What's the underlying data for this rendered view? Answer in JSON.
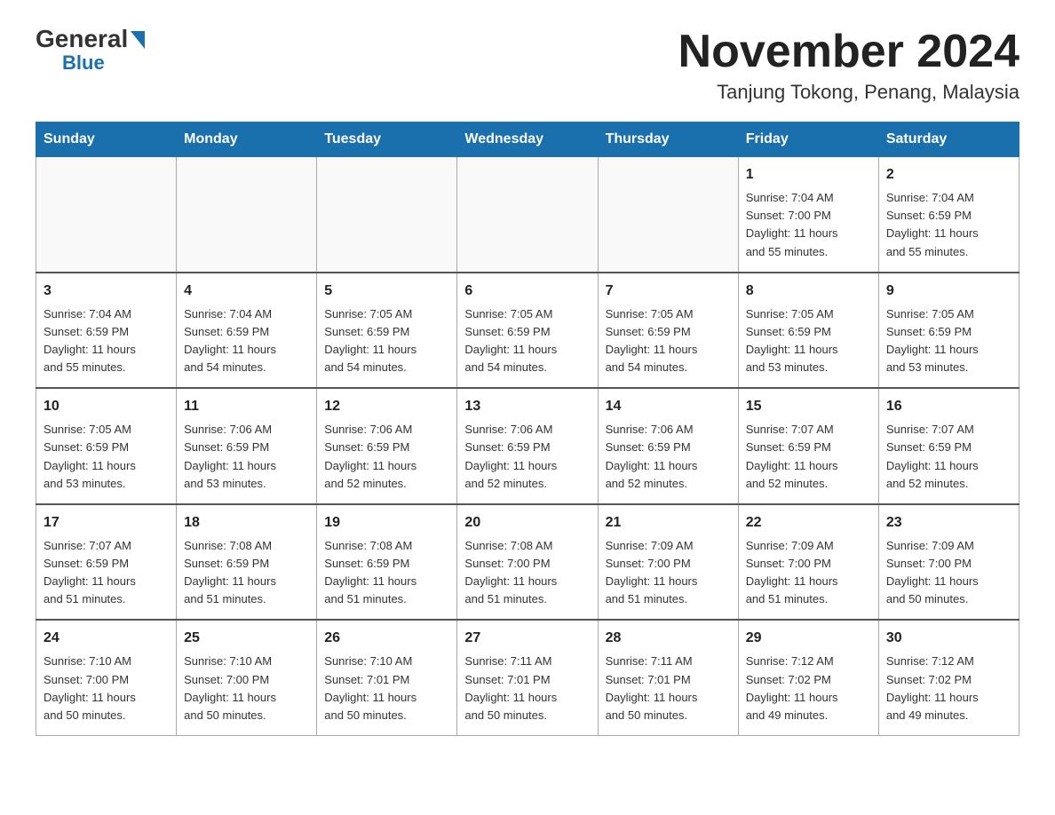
{
  "logo": {
    "general": "General",
    "blue": "Blue",
    "triangle": "▶"
  },
  "title": "November 2024",
  "subtitle": "Tanjung Tokong, Penang, Malaysia",
  "calendar": {
    "headers": [
      "Sunday",
      "Monday",
      "Tuesday",
      "Wednesday",
      "Thursday",
      "Friday",
      "Saturday"
    ],
    "weeks": [
      [
        {
          "day": "",
          "info": ""
        },
        {
          "day": "",
          "info": ""
        },
        {
          "day": "",
          "info": ""
        },
        {
          "day": "",
          "info": ""
        },
        {
          "day": "",
          "info": ""
        },
        {
          "day": "1",
          "info": "Sunrise: 7:04 AM\nSunset: 7:00 PM\nDaylight: 11 hours\nand 55 minutes."
        },
        {
          "day": "2",
          "info": "Sunrise: 7:04 AM\nSunset: 6:59 PM\nDaylight: 11 hours\nand 55 minutes."
        }
      ],
      [
        {
          "day": "3",
          "info": "Sunrise: 7:04 AM\nSunset: 6:59 PM\nDaylight: 11 hours\nand 55 minutes."
        },
        {
          "day": "4",
          "info": "Sunrise: 7:04 AM\nSunset: 6:59 PM\nDaylight: 11 hours\nand 54 minutes."
        },
        {
          "day": "5",
          "info": "Sunrise: 7:05 AM\nSunset: 6:59 PM\nDaylight: 11 hours\nand 54 minutes."
        },
        {
          "day": "6",
          "info": "Sunrise: 7:05 AM\nSunset: 6:59 PM\nDaylight: 11 hours\nand 54 minutes."
        },
        {
          "day": "7",
          "info": "Sunrise: 7:05 AM\nSunset: 6:59 PM\nDaylight: 11 hours\nand 54 minutes."
        },
        {
          "day": "8",
          "info": "Sunrise: 7:05 AM\nSunset: 6:59 PM\nDaylight: 11 hours\nand 53 minutes."
        },
        {
          "day": "9",
          "info": "Sunrise: 7:05 AM\nSunset: 6:59 PM\nDaylight: 11 hours\nand 53 minutes."
        }
      ],
      [
        {
          "day": "10",
          "info": "Sunrise: 7:05 AM\nSunset: 6:59 PM\nDaylight: 11 hours\nand 53 minutes."
        },
        {
          "day": "11",
          "info": "Sunrise: 7:06 AM\nSunset: 6:59 PM\nDaylight: 11 hours\nand 53 minutes."
        },
        {
          "day": "12",
          "info": "Sunrise: 7:06 AM\nSunset: 6:59 PM\nDaylight: 11 hours\nand 52 minutes."
        },
        {
          "day": "13",
          "info": "Sunrise: 7:06 AM\nSunset: 6:59 PM\nDaylight: 11 hours\nand 52 minutes."
        },
        {
          "day": "14",
          "info": "Sunrise: 7:06 AM\nSunset: 6:59 PM\nDaylight: 11 hours\nand 52 minutes."
        },
        {
          "day": "15",
          "info": "Sunrise: 7:07 AM\nSunset: 6:59 PM\nDaylight: 11 hours\nand 52 minutes."
        },
        {
          "day": "16",
          "info": "Sunrise: 7:07 AM\nSunset: 6:59 PM\nDaylight: 11 hours\nand 52 minutes."
        }
      ],
      [
        {
          "day": "17",
          "info": "Sunrise: 7:07 AM\nSunset: 6:59 PM\nDaylight: 11 hours\nand 51 minutes."
        },
        {
          "day": "18",
          "info": "Sunrise: 7:08 AM\nSunset: 6:59 PM\nDaylight: 11 hours\nand 51 minutes."
        },
        {
          "day": "19",
          "info": "Sunrise: 7:08 AM\nSunset: 6:59 PM\nDaylight: 11 hours\nand 51 minutes."
        },
        {
          "day": "20",
          "info": "Sunrise: 7:08 AM\nSunset: 7:00 PM\nDaylight: 11 hours\nand 51 minutes."
        },
        {
          "day": "21",
          "info": "Sunrise: 7:09 AM\nSunset: 7:00 PM\nDaylight: 11 hours\nand 51 minutes."
        },
        {
          "day": "22",
          "info": "Sunrise: 7:09 AM\nSunset: 7:00 PM\nDaylight: 11 hours\nand 51 minutes."
        },
        {
          "day": "23",
          "info": "Sunrise: 7:09 AM\nSunset: 7:00 PM\nDaylight: 11 hours\nand 50 minutes."
        }
      ],
      [
        {
          "day": "24",
          "info": "Sunrise: 7:10 AM\nSunset: 7:00 PM\nDaylight: 11 hours\nand 50 minutes."
        },
        {
          "day": "25",
          "info": "Sunrise: 7:10 AM\nSunset: 7:00 PM\nDaylight: 11 hours\nand 50 minutes."
        },
        {
          "day": "26",
          "info": "Sunrise: 7:10 AM\nSunset: 7:01 PM\nDaylight: 11 hours\nand 50 minutes."
        },
        {
          "day": "27",
          "info": "Sunrise: 7:11 AM\nSunset: 7:01 PM\nDaylight: 11 hours\nand 50 minutes."
        },
        {
          "day": "28",
          "info": "Sunrise: 7:11 AM\nSunset: 7:01 PM\nDaylight: 11 hours\nand 50 minutes."
        },
        {
          "day": "29",
          "info": "Sunrise: 7:12 AM\nSunset: 7:02 PM\nDaylight: 11 hours\nand 49 minutes."
        },
        {
          "day": "30",
          "info": "Sunrise: 7:12 AM\nSunset: 7:02 PM\nDaylight: 11 hours\nand 49 minutes."
        }
      ]
    ]
  }
}
